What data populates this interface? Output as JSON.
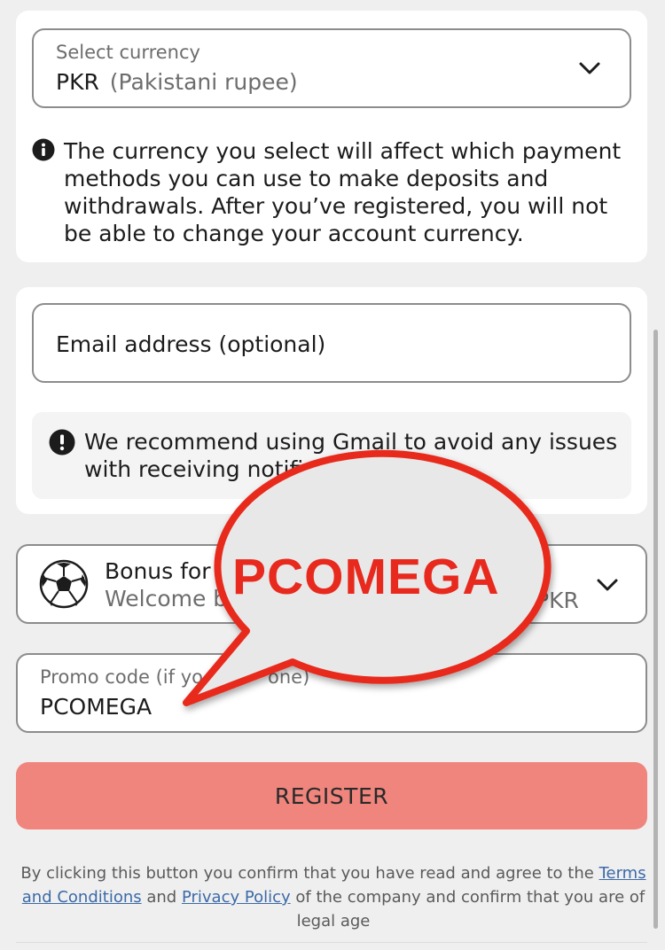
{
  "currency": {
    "label": "Select currency",
    "code": "PKR",
    "name": "(Pakistani rupee)",
    "info": "The currency you select will affect which payment methods you can use to make deposits and withdrawals. After you’ve registered, you will not be able to change your account currency."
  },
  "email": {
    "placeholder": "Email address (optional)",
    "notice": "We recommend using Gmail to avoid any issues with receiving notifications"
  },
  "bonus": {
    "title": "Bonus for",
    "subtitle": "Welcome b",
    "currency_suffix": "PKR"
  },
  "promo": {
    "label": "Promo code (if yo",
    "label_tail": "one)",
    "value": "PCOMEGA"
  },
  "overlay": {
    "bubble_text": "PCOMEGA",
    "color": "#e8291d"
  },
  "register": {
    "label": "REGISTER",
    "color": "#f0857d"
  },
  "legal": {
    "prefix": "By clicking this button you confirm that you have read and agree to the",
    "terms_link": "Terms and Conditions",
    "and": "and",
    "privacy_link": "Privacy Policy",
    "suffix": "of the company and confirm that you are of legal age"
  },
  "icons": {
    "info": "info-icon",
    "alert": "exclamation-icon",
    "bonus": "soccer-ball-icon",
    "dropdown": "chevron-down-icon"
  }
}
